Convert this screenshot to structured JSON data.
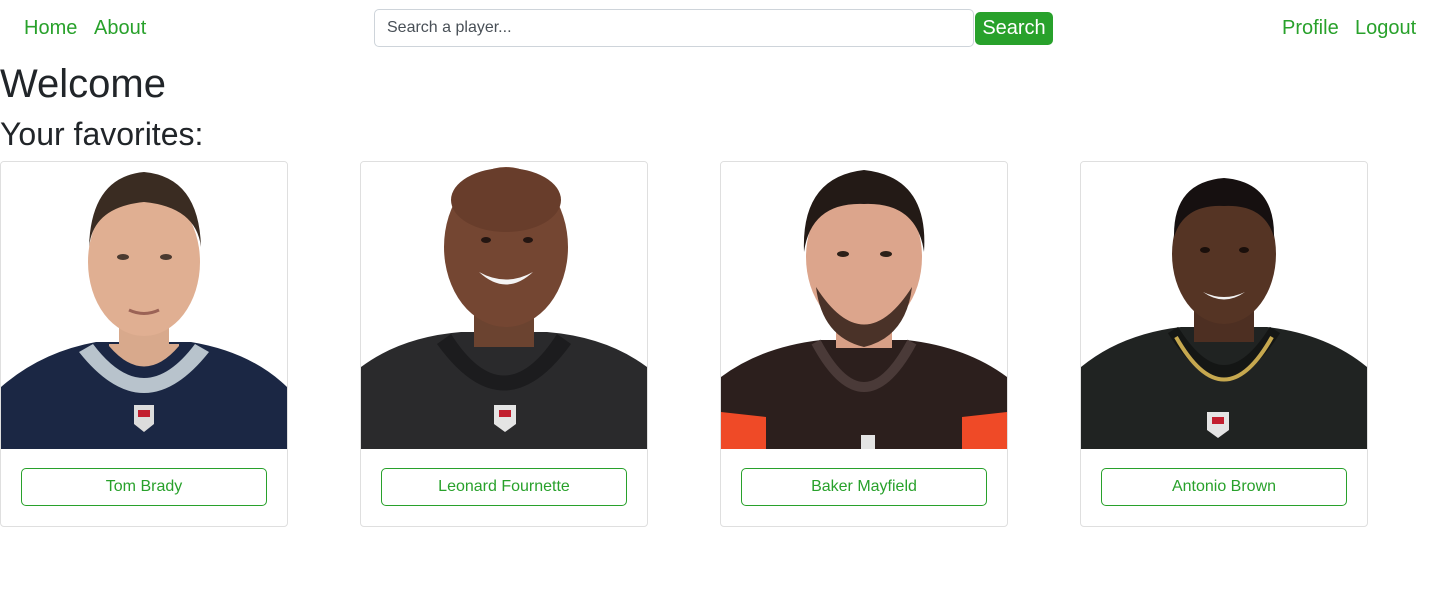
{
  "nav": {
    "home": "Home",
    "about": "About",
    "profile": "Profile",
    "logout": "Logout",
    "search_placeholder": "Search a player...",
    "search_value": "",
    "search_button": "Search"
  },
  "page": {
    "title": "Welcome",
    "favorites_heading": "Your favorites:"
  },
  "favorites": [
    {
      "name": "Tom Brady",
      "photo": "player-photo-tom-brady",
      "jersey": "navy"
    },
    {
      "name": "Leonard Fournette",
      "photo": "player-photo-leonard-fournette",
      "jersey": "black"
    },
    {
      "name": "Baker Mayfield",
      "photo": "player-photo-baker-mayfield",
      "jersey": "brown-orange"
    },
    {
      "name": "Antonio Brown",
      "photo": "player-photo-antonio-brown",
      "jersey": "black"
    }
  ],
  "colors": {
    "accent": "#28a12b",
    "text": "#212529",
    "card_border": "#dfdfdf",
    "input_border": "#ced4da"
  }
}
